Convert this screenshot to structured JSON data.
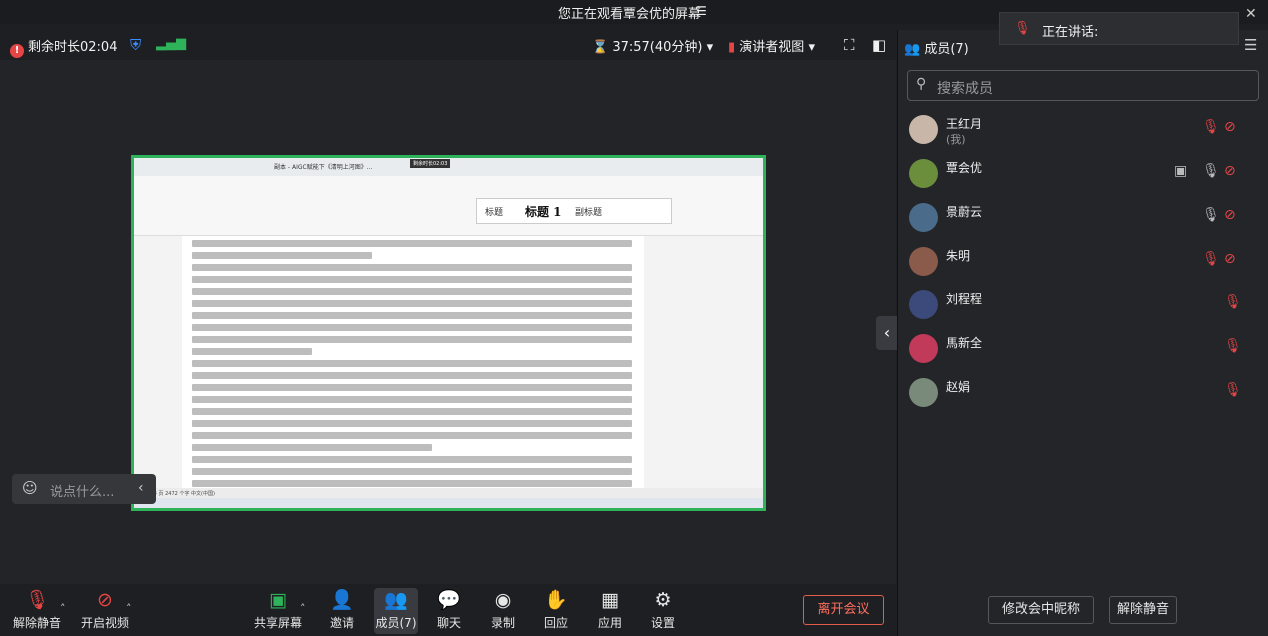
{
  "banner": {
    "text": "您正在观看覃会优的屏幕",
    "menu_icon": "list-icon"
  },
  "toolbar": {
    "remaining": "剩余时长02:04",
    "timer": "37:57(40分钟)",
    "view": "演讲者视图"
  },
  "panel": {
    "title": "成员(7)",
    "search_placeholder": "搜索成员",
    "members": [
      {
        "name": "王红月",
        "sub": "(我)",
        "color": "#c8b7a8"
      },
      {
        "name": "覃会优",
        "sub": "",
        "color": "#6b8e3d"
      },
      {
        "name": "景蔚云",
        "sub": "",
        "color": "#4a6b8a"
      },
      {
        "name": "朱明",
        "sub": "",
        "color": "#8a5a4a"
      },
      {
        "name": "刘程程",
        "sub": "",
        "color": "#3b4a7a"
      },
      {
        "name": "馬新全",
        "sub": "",
        "color": "#c23a5a"
      },
      {
        "name": "赵娟",
        "sub": "",
        "color": "#7a8a7a"
      }
    ],
    "rename_btn": "修改会中昵称",
    "unmute_btn": "解除静音"
  },
  "speaking": {
    "label": "正在讲话:"
  },
  "chat": {
    "placeholder": "说点什么..."
  },
  "bottom": {
    "unmute": "解除静音",
    "video": "开启视频",
    "share": "共享屏幕",
    "invite": "邀请",
    "members": "成员(7)",
    "chat": "聊天",
    "record": "录制",
    "react": "回应",
    "apps": "应用",
    "settings": "设置",
    "leave": "离开会议"
  },
  "doc": {
    "filename": "副本 - AIGC赋能下《清明上河图》...",
    "record_label": "剩余时长02:03",
    "style_normal": "标题",
    "style_h1": "标题 1",
    "style_sub": "副标题",
    "status": "第 14 页   2472 个字   中文(中国)"
  },
  "colors": {
    "accent_green": "#2fb35a",
    "danger": "#e64545",
    "leave": "#ff6f5f"
  }
}
